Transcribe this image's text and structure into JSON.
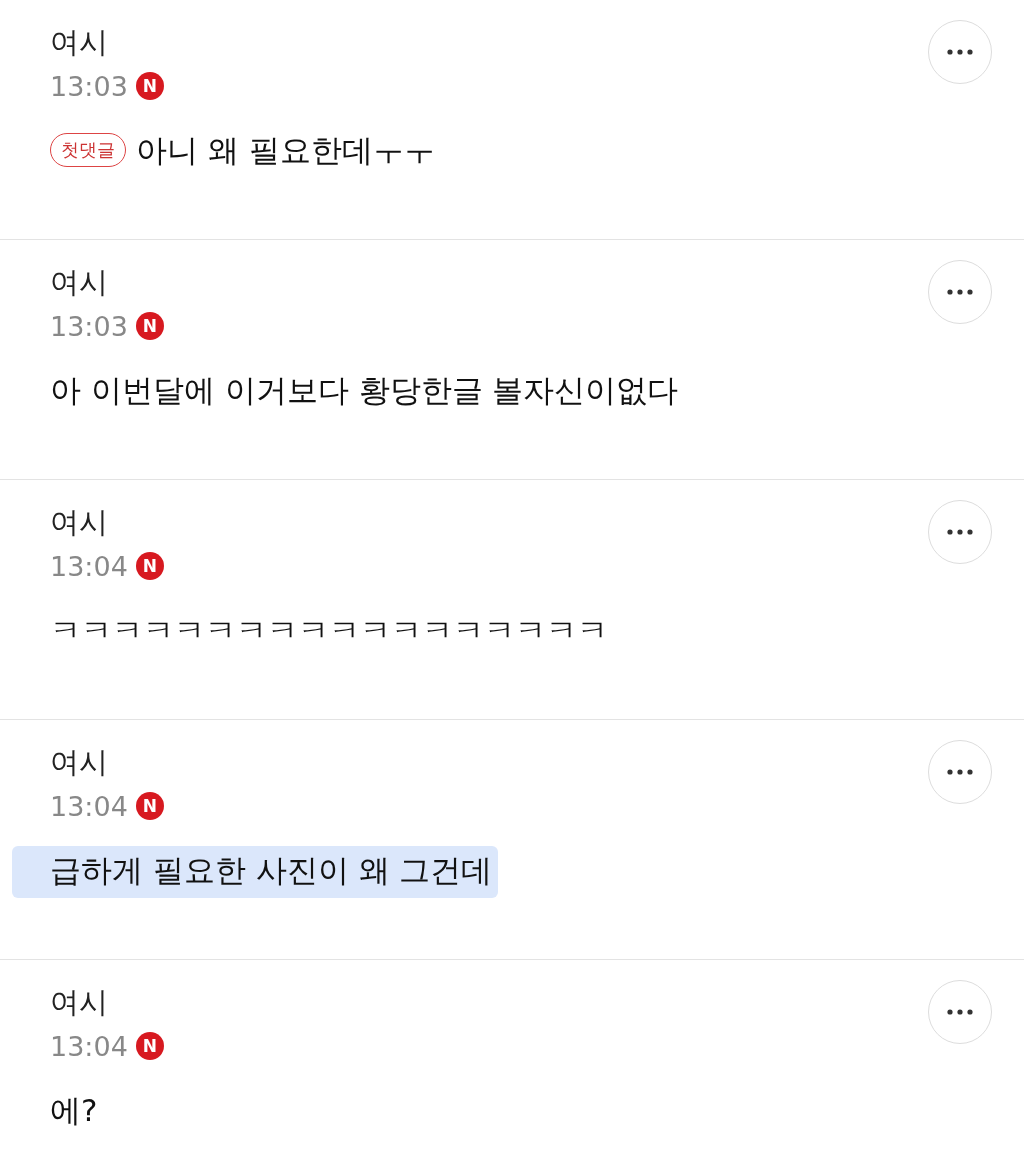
{
  "comments": [
    {
      "author": "여시",
      "time": "13:03",
      "new_mark": "N",
      "badge": "첫댓글",
      "text": "아니 왜 필요한데ㅜㅜ",
      "highlighted": false
    },
    {
      "author": "여시",
      "time": "13:03",
      "new_mark": "N",
      "text": "아 이번달에 이거보다 황당한글 볼자신이없다",
      "highlighted": false
    },
    {
      "author": "여시",
      "time": "13:04",
      "new_mark": "N",
      "text": "ㅋㅋㅋㅋㅋㅋㅋㅋㅋㅋㅋㅋㅋㅋㅋㅋㅋㅋ",
      "highlighted": false
    },
    {
      "author": "여시",
      "time": "13:04",
      "new_mark": "N",
      "text": "급하게 필요한 사진이 왜 그건데",
      "highlighted": true
    },
    {
      "author": "여시",
      "time": "13:04",
      "new_mark": "N",
      "text": "에?",
      "highlighted": false
    }
  ]
}
